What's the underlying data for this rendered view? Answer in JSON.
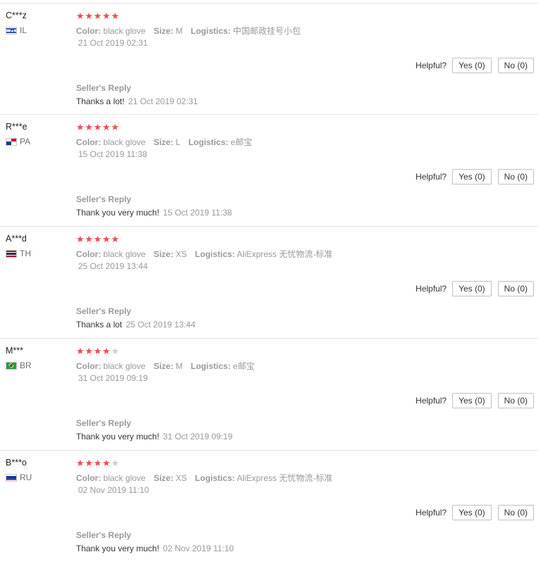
{
  "labels": {
    "color": "Color:",
    "size": "Size:",
    "logistics": "Logistics:",
    "helpful": "Helpful?",
    "sellers_reply": "Seller's Reply"
  },
  "colors": {
    "star_on": "#e94d4d",
    "star_off": "#cccccc",
    "muted_text": "#999999"
  },
  "reviews": [
    {
      "user": "C***z",
      "country": "IL",
      "flag_icon": "israel-flag-icon",
      "rating": 5,
      "color": "black glove",
      "size": "M",
      "logistics": "中国邮政挂号小包",
      "date": "21 Oct 2019 02:31",
      "yes_label": "Yes (0)",
      "no_label": "No (0)",
      "reply_text": "Thanks a lot!",
      "reply_date": "21 Oct 2019 02:31"
    },
    {
      "user": "R***e",
      "country": "PA",
      "flag_icon": "panama-flag-icon",
      "rating": 5,
      "color": "black glove",
      "size": "L",
      "logistics": "e邮宝",
      "date": "15 Oct 2019 11:38",
      "yes_label": "Yes (0)",
      "no_label": "No (0)",
      "reply_text": "Thank you very much!",
      "reply_date": "15 Oct 2019 11:38"
    },
    {
      "user": "A***d",
      "country": "TH",
      "flag_icon": "thailand-flag-icon",
      "rating": 5,
      "color": "black glove",
      "size": "XS",
      "logistics": "AliExpress 无忧物流-标准",
      "date": "25 Oct 2019 13:44",
      "yes_label": "Yes (0)",
      "no_label": "No (0)",
      "reply_text": "Thanks a lot",
      "reply_date": "25 Oct 2019 13:44"
    },
    {
      "user": "M***",
      "country": "BR",
      "flag_icon": "brazil-flag-icon",
      "rating": 4,
      "color": "black glove",
      "size": "M",
      "logistics": "e邮宝",
      "date": "31 Oct 2019 09:19",
      "yes_label": "Yes (0)",
      "no_label": "No (0)",
      "reply_text": "Thank you very much!",
      "reply_date": "31 Oct 2019 09:19"
    },
    {
      "user": "B***o",
      "country": "RU",
      "flag_icon": "russia-flag-icon",
      "rating": 4,
      "color": "black glove",
      "size": "XS",
      "logistics": "AliExpress 无忧物流-标准",
      "date": "02 Nov 2019 11:10",
      "yes_label": "Yes (0)",
      "no_label": "No (0)",
      "reply_text": "Thank you very much!",
      "reply_date": "02 Nov 2019 11:10"
    }
  ]
}
